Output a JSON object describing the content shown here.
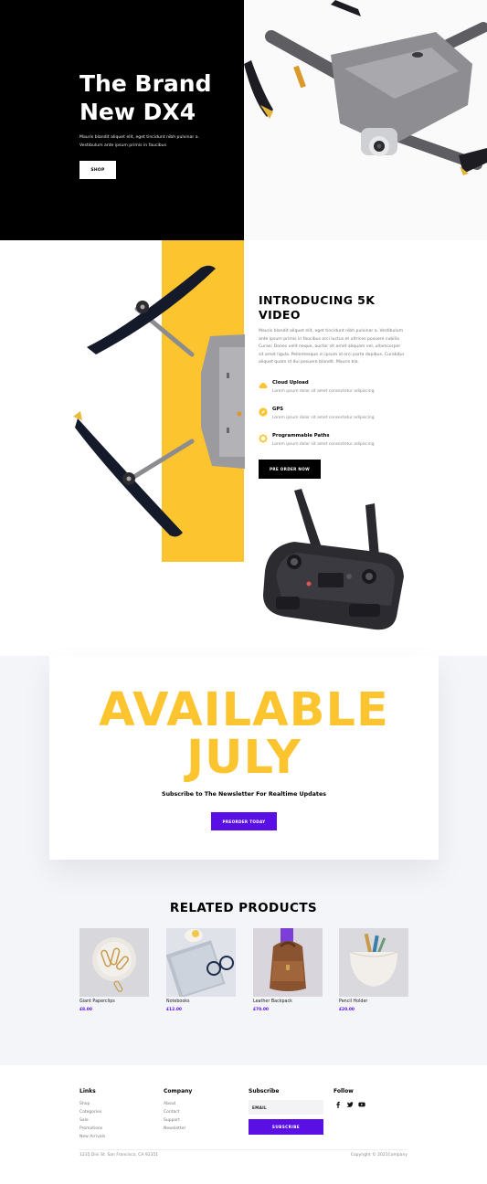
{
  "hero": {
    "title_line1": "The Brand",
    "title_line2": "New DX4",
    "text_line1": "Mauris blandit aliquet elit, eget tincidunt nibh pulvinar a.",
    "text_line2": "Vestibulum ante ipsum primis in faucibus",
    "shop_label": "SHOP"
  },
  "feature": {
    "title_line1": "INTRODUCING 5K",
    "title_line2": "VIDEO",
    "description": "Mauris blandit aliquet elit, eget tincidunt nibh pulvinar a. Vestibulum ante ipsum primis in faucibus orci luctus et ultrices posuere cubilia Curae; Donec velit neque, auctor sit amet aliquam vel, ullamcorper sit amet ligula. Pellentesque in ipsum id orci porta dapibus. Curabitur aliquet quam id dui posuere blandit. Mauris bla.",
    "items": [
      {
        "name": "Cloud Upload",
        "desc": "Lorem ipsum dolor sit amet consectetur adipiscing",
        "icon": "cloud-icon"
      },
      {
        "name": "GPS",
        "desc": "Lorem ipsum dolor sit amet consectetur adipiscing",
        "icon": "compass-icon"
      },
      {
        "name": "Programmable Paths",
        "desc": "Lorem ipsum dolor sit amet consectetur adipiscing",
        "icon": "gear-icon"
      }
    ],
    "preorder_label": "PRE ORDER NOW"
  },
  "available": {
    "line1": "AVAILABLE",
    "line2": "JULY",
    "subtitle": "Subscribe to The Newsletter For Realtime Updates",
    "button_label": "PREORDER TODAY"
  },
  "related": {
    "title": "RELATED PRODUCTS",
    "products": [
      {
        "name": "Giant Paperclips",
        "price": "£8.00"
      },
      {
        "name": "Notebooks",
        "price": "£12.00"
      },
      {
        "name": "Leather Backpack",
        "price": "£70.00"
      },
      {
        "name": "Pencil Holder",
        "price": "£20.00"
      }
    ]
  },
  "footer": {
    "links_title": "Links",
    "links": [
      "Shop",
      "Categories",
      "Sale",
      "Promotions",
      "New Arrivals"
    ],
    "company_title": "Company",
    "company": [
      "About",
      "Contact",
      "Support",
      "Newsletter"
    ],
    "subscribe_title": "Subscribe",
    "email_placeholder": "EMAIL",
    "subscribe_label": "SUBSCRIBE",
    "follow_title": "Follow",
    "social": [
      "facebook-icon",
      "twitter-icon",
      "youtube-icon"
    ],
    "address": "1235 Divi St. San Francisco, CA 92351",
    "copyright": "Copyright © 2021Company"
  },
  "colors": {
    "accent_yellow": "#fcc42e",
    "accent_purple": "#5a0fe4",
    "dark": "#000000"
  }
}
